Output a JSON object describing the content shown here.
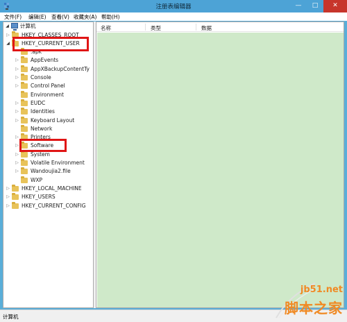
{
  "window": {
    "title": "注册表编辑器",
    "controls": {
      "minimize": "—",
      "maximize": "□",
      "close": "✕"
    }
  },
  "menu": [
    "文件(F)",
    "编辑(E)",
    "查看(V)",
    "收藏夹(A)",
    "帮助(H)"
  ],
  "tree": {
    "root": "计算机",
    "nodes": [
      {
        "label": "HKEY_CLASSES_ROOT",
        "level": 1,
        "expander": "▷"
      },
      {
        "label": "HKEY_CURRENT_USER",
        "level": 1,
        "expander": "◢"
      },
      {
        "label": ".apk",
        "level": 2,
        "expander": ""
      },
      {
        "label": "AppEvents",
        "level": 2,
        "expander": "▷"
      },
      {
        "label": "AppXBackupContentTy",
        "level": 2,
        "expander": "▷"
      },
      {
        "label": "Console",
        "level": 2,
        "expander": "▷"
      },
      {
        "label": "Control Panel",
        "level": 2,
        "expander": "▷"
      },
      {
        "label": "Environment",
        "level": 2,
        "expander": ""
      },
      {
        "label": "EUDC",
        "level": 2,
        "expander": "▷"
      },
      {
        "label": "Identities",
        "level": 2,
        "expander": "▷"
      },
      {
        "label": "Keyboard Layout",
        "level": 2,
        "expander": "▷"
      },
      {
        "label": "Network",
        "level": 2,
        "expander": ""
      },
      {
        "label": "Printers",
        "level": 2,
        "expander": "▷"
      },
      {
        "label": "Software",
        "level": 2,
        "expander": "▷"
      },
      {
        "label": "System",
        "level": 2,
        "expander": "▷"
      },
      {
        "label": "Volatile Environment",
        "level": 2,
        "expander": "▷"
      },
      {
        "label": "Wandoujia2.file",
        "level": 2,
        "expander": "▷"
      },
      {
        "label": "WXP",
        "level": 2,
        "expander": ""
      },
      {
        "label": "HKEY_LOCAL_MACHINE",
        "level": 1,
        "expander": "▷"
      },
      {
        "label": "HKEY_USERS",
        "level": 1,
        "expander": "▷"
      },
      {
        "label": "HKEY_CURRENT_CONFIG",
        "level": 1,
        "expander": "▷"
      }
    ]
  },
  "list": {
    "columns": [
      "名称",
      "类型",
      "数据"
    ]
  },
  "status": "计算机",
  "watermark": {
    "url": "jb51.net",
    "name": "脚本之家"
  },
  "colors": {
    "titlebar": "#4da3d6",
    "list_background": "#cfe9c9",
    "highlight": "#e01515",
    "watermark": "#f08a24"
  }
}
